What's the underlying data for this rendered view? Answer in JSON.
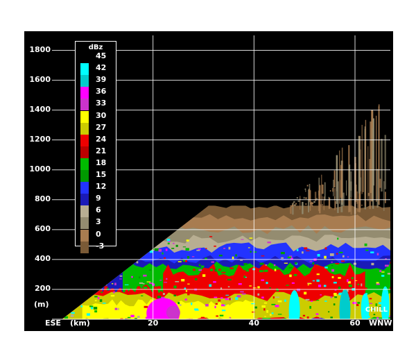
{
  "chart_data": {
    "type": "heatmap",
    "title": "",
    "x_axis": {
      "unit_label": "(km)",
      "ticks": [
        20,
        40,
        60
      ],
      "range": [
        0,
        67
      ],
      "left_end_label": "ESE",
      "right_end_label": "WNW"
    },
    "y_axis": {
      "unit_label": "(m)",
      "ticks": [
        200,
        400,
        600,
        800,
        1000,
        1200,
        1400,
        1600,
        1800
      ],
      "range": [
        0,
        1900
      ]
    },
    "grid": true,
    "source_label": "CHILL",
    "colorbar": {
      "title": "dBz",
      "levels": [
        {
          "label": "45",
          "color": null
        },
        {
          "label": "42",
          "color": "#00ffff"
        },
        {
          "label": "39",
          "color": "#00cccc"
        },
        {
          "label": "36",
          "color": "#ff00ff"
        },
        {
          "label": "33",
          "color": "#cc33cc"
        },
        {
          "label": "30",
          "color": "#ffff00"
        },
        {
          "label": "27",
          "color": "#cccc00"
        },
        {
          "label": "24",
          "color": "#ee0000"
        },
        {
          "label": "21",
          "color": "#bb0000"
        },
        {
          "label": "18",
          "color": "#00bb00"
        },
        {
          "label": "15",
          "color": "#009900"
        },
        {
          "label": "12",
          "color": "#2233ff"
        },
        {
          "label": "9",
          "color": "#1a1ab8"
        },
        {
          "label": "6",
          "color": "#b8ae92"
        },
        {
          "label": "3",
          "color": "#948c70"
        },
        {
          "label": "0",
          "color": "#a87c50"
        },
        {
          "label": "-3",
          "color": "#7a5a36"
        }
      ]
    },
    "reflectivity_layers": [
      {
        "dbz": "-3 to 3",
        "description": "beam-edge and clear-air echoes",
        "x_range_km": [
          30,
          67
        ],
        "height_range_m": [
          580,
          760
        ]
      },
      {
        "dbz": "6 to 9",
        "description": "light echo band",
        "x_range_km": [
          2,
          67
        ],
        "height_range_m": [
          380,
          620
        ]
      },
      {
        "dbz": "12 to 15",
        "description": "blue echo band",
        "x_range_km": [
          3,
          67
        ],
        "height_range_m": [
          330,
          500
        ]
      },
      {
        "dbz": "18 to 21",
        "description": "green echo band",
        "x_range_km": [
          4,
          67
        ],
        "height_range_m": [
          230,
          400
        ]
      },
      {
        "dbz": "24 to 27",
        "description": "red echo band",
        "x_range_km": [
          5,
          62
        ],
        "height_range_m": [
          60,
          340
        ]
      },
      {
        "dbz": "30 to 42",
        "description": "strongest cores near the ground",
        "x_range_km": [
          2,
          67
        ],
        "height_range_m": [
          0,
          160
        ]
      },
      {
        "dbz": "-3 to 3",
        "description": "vertical streaks (upper region)",
        "x_range_km": [
          47,
          66
        ],
        "height_range_m": [
          700,
          1550
        ]
      }
    ]
  }
}
